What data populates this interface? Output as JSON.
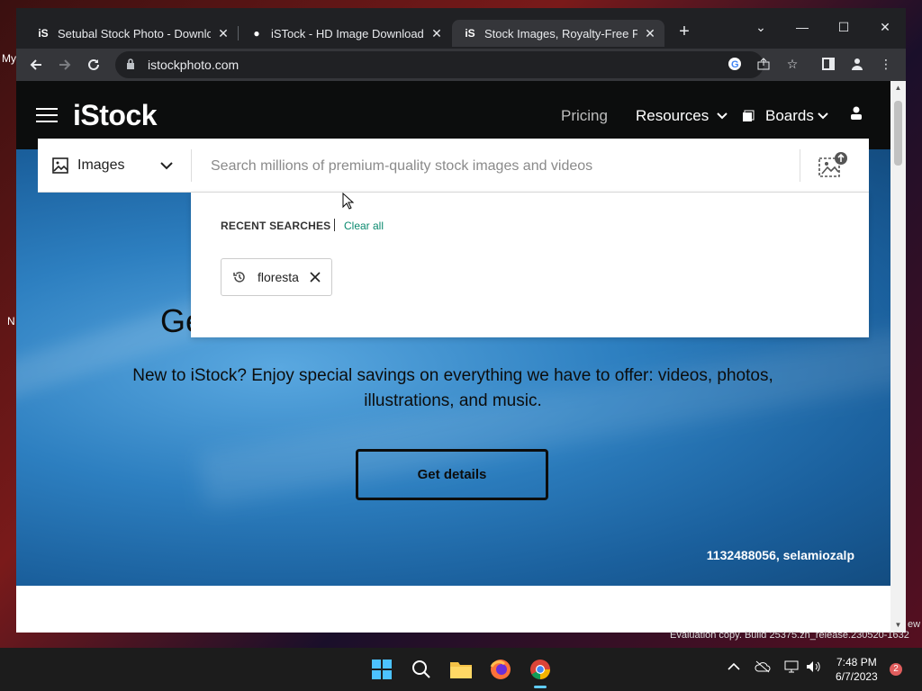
{
  "desktop": {
    "left_labels": [
      "My",
      "N"
    ],
    "right_label": "ew"
  },
  "browser": {
    "tabs": [
      {
        "favicon": "iS",
        "title": "Setubal Stock Photo - Download",
        "active": false
      },
      {
        "favicon": "●",
        "title": "iSTock - HD Image Downloader",
        "active": false
      },
      {
        "favicon": "iS",
        "title": "Stock Images, Royalty-Free Pictu",
        "active": true
      }
    ],
    "new_tab": "+",
    "window_controls": {
      "dropdown": "⌄",
      "minimize": "—",
      "maximize": "☐",
      "close": "✕"
    },
    "url": "istockphoto.com"
  },
  "site": {
    "logo": "iStock",
    "nav": {
      "pricing": "Pricing",
      "resources": "Resources",
      "boards": "Boards"
    },
    "search": {
      "media_type": "Images",
      "placeholder": "Search millions of premium-quality stock images and videos"
    },
    "recent": {
      "title": "RECENT SEARCHES",
      "clear_all": "Clear all",
      "items": [
        "floresta"
      ]
    },
    "hero": {
      "heading_partial": "Ge",
      "text": "New to iStock? Enjoy special savings on everything we have to offer: videos, photos, illustrations, and music.",
      "button": "Get details",
      "credit": "1132488056, selamiozalp"
    }
  },
  "os": {
    "watermark": "Evaluation copy. Build 25375.zn_release.230520-1632",
    "time": "7:48 PM",
    "date": "6/7/2023",
    "notifications": "2"
  }
}
